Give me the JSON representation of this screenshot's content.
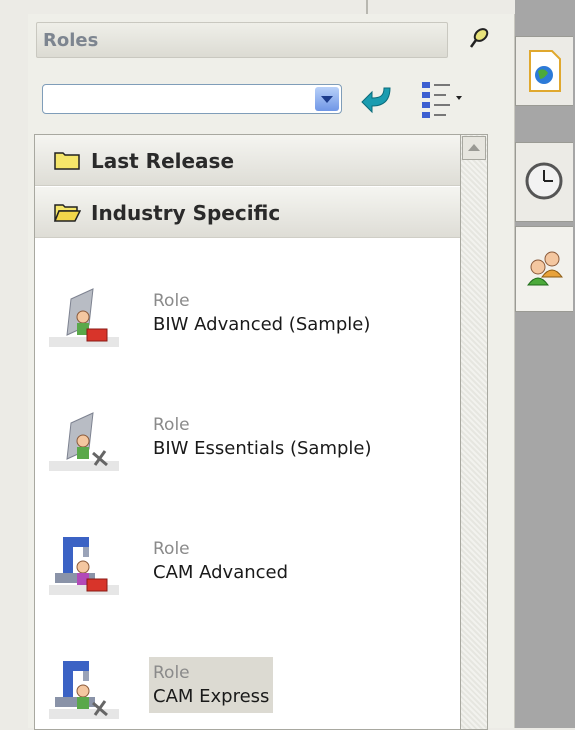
{
  "panel": {
    "title": "Roles"
  },
  "toolbar": {
    "search_value": "",
    "search_placeholder": ""
  },
  "categories": [
    {
      "label": "Last Release",
      "state": "collapsed"
    },
    {
      "label": "Industry Specific",
      "state": "expanded"
    }
  ],
  "roles": [
    {
      "type": "Role",
      "name": "BIW Advanced (Sample)",
      "icon": "biw-advanced-role-icon"
    },
    {
      "type": "Role",
      "name": "BIW Essentials (Sample)",
      "icon": "biw-essentials-role-icon"
    },
    {
      "type": "Role",
      "name": "CAM Advanced",
      "icon": "cam-advanced-role-icon"
    },
    {
      "type": "Role",
      "name": "CAM Express",
      "icon": "cam-express-role-icon",
      "selected": true
    }
  ],
  "side_tabs": [
    {
      "icon": "web-page-icon"
    },
    {
      "icon": "history-clock-icon"
    },
    {
      "icon": "roles-users-icon",
      "active": true
    }
  ],
  "colors": {
    "panel_bg": "#efefe9",
    "header_text": "#7d8590",
    "selected_bg": "#dcdad2",
    "right_strip": "#a6a6a6"
  }
}
